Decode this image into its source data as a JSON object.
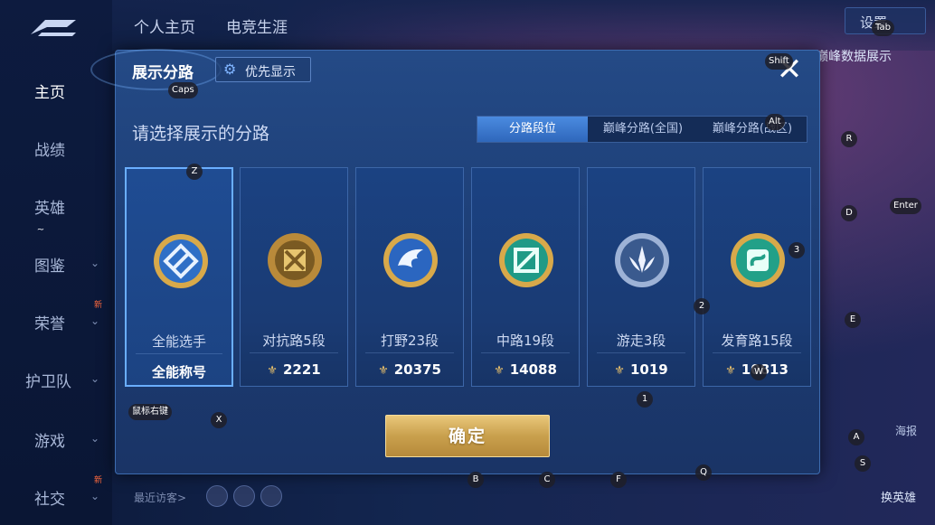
{
  "sidebar": {
    "items": [
      {
        "label": "主页",
        "active": true
      },
      {
        "label": "战绩"
      },
      {
        "label": "英雄"
      },
      {
        "label": "图鉴",
        "chevron": true
      },
      {
        "label": "荣誉",
        "chevron": true,
        "badge": "新"
      },
      {
        "label": "护卫队",
        "chevron": true
      },
      {
        "label": "游戏",
        "chevron": true
      },
      {
        "label": "社交",
        "chevron": true,
        "badge": "新"
      }
    ]
  },
  "header": {
    "tabs": [
      "个人主页",
      "电竞生涯"
    ],
    "settings_label": "设置",
    "peak_button": "巅峰数据展示"
  },
  "footer": {
    "recent_label": "最近访客>",
    "change_hero": "换英雄",
    "report": "海报"
  },
  "dialog": {
    "title": "展示分路",
    "priority_label": "优先显示",
    "close": "✕",
    "subtitle": "请选择展示的分路",
    "tabs": [
      "分路段位",
      "巅峰分路(全国)",
      "巅峰分路(战区)"
    ],
    "active_tab": 0,
    "cards": [
      {
        "name": "全能选手",
        "score": "全能称号",
        "badge": "all-rounder-icon",
        "selected": true
      },
      {
        "name": "对抗路5段",
        "score": "2221",
        "badge": "clash-lane-icon"
      },
      {
        "name": "打野23段",
        "score": "20375",
        "badge": "jungle-icon"
      },
      {
        "name": "中路19段",
        "score": "14088",
        "badge": "mid-lane-icon"
      },
      {
        "name": "游走3段",
        "score": "1019",
        "badge": "roam-icon"
      },
      {
        "name": "发育路15段",
        "score": "10813",
        "badge": "farm-lane-icon"
      }
    ],
    "confirm_label": "确定"
  },
  "key_hints": [
    {
      "key": "Tab"
    },
    {
      "key": "Shift"
    },
    {
      "key": "Caps"
    },
    {
      "key": "Alt"
    },
    {
      "key": "R"
    },
    {
      "key": "Z"
    },
    {
      "key": "D"
    },
    {
      "key": "Enter"
    },
    {
      "key": "~"
    },
    {
      "key": "3"
    },
    {
      "key": "2"
    },
    {
      "key": "E"
    },
    {
      "key": "W"
    },
    {
      "key": "1"
    },
    {
      "key": "鼠标右键"
    },
    {
      "key": "X"
    },
    {
      "key": "A"
    },
    {
      "key": "S"
    },
    {
      "key": "Q"
    },
    {
      "key": "B"
    },
    {
      "key": "C"
    },
    {
      "key": "F"
    }
  ],
  "colors": {
    "accent": "#4b8be0",
    "gold": "#c9a04d",
    "panel": "#1c3c73"
  }
}
